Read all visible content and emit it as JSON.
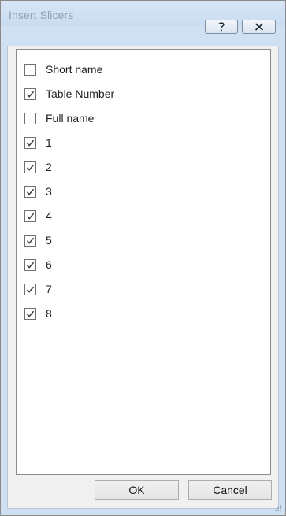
{
  "dialog": {
    "title": "Insert Slicers",
    "help_icon": "help-question-icon",
    "close_icon": "close-x-icon"
  },
  "fields": [
    {
      "label": "Short name",
      "checked": false
    },
    {
      "label": "Table Number",
      "checked": true
    },
    {
      "label": "Full name",
      "checked": false
    },
    {
      "label": "1",
      "checked": true
    },
    {
      "label": "2",
      "checked": true
    },
    {
      "label": "3",
      "checked": true
    },
    {
      "label": "4",
      "checked": true
    },
    {
      "label": "5",
      "checked": true
    },
    {
      "label": "6",
      "checked": true
    },
    {
      "label": "7",
      "checked": true
    },
    {
      "label": "8",
      "checked": true
    }
  ],
  "buttons": {
    "ok_label": "OK",
    "cancel_label": "Cancel"
  },
  "colors": {
    "window_frame": "#cfe0f2",
    "title_text": "#8ea1b5",
    "checkmark": "#3a3a3a"
  }
}
